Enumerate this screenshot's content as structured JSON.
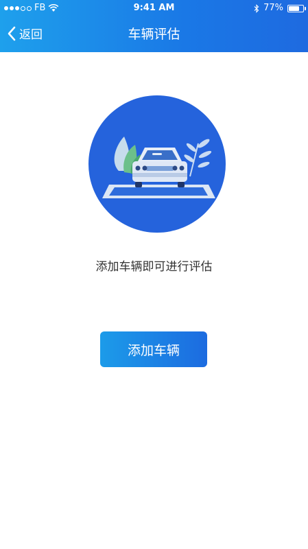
{
  "status_bar": {
    "carrier": "FB",
    "time": "9:41 AM",
    "battery": "77%"
  },
  "nav": {
    "back_label": "返回",
    "title": "车辆评估"
  },
  "content": {
    "hint": "添加车辆即可进行评估",
    "add_button_label": "添加车辆"
  },
  "colors": {
    "accent": "#1c7fe6",
    "circle": "#2563dc"
  }
}
